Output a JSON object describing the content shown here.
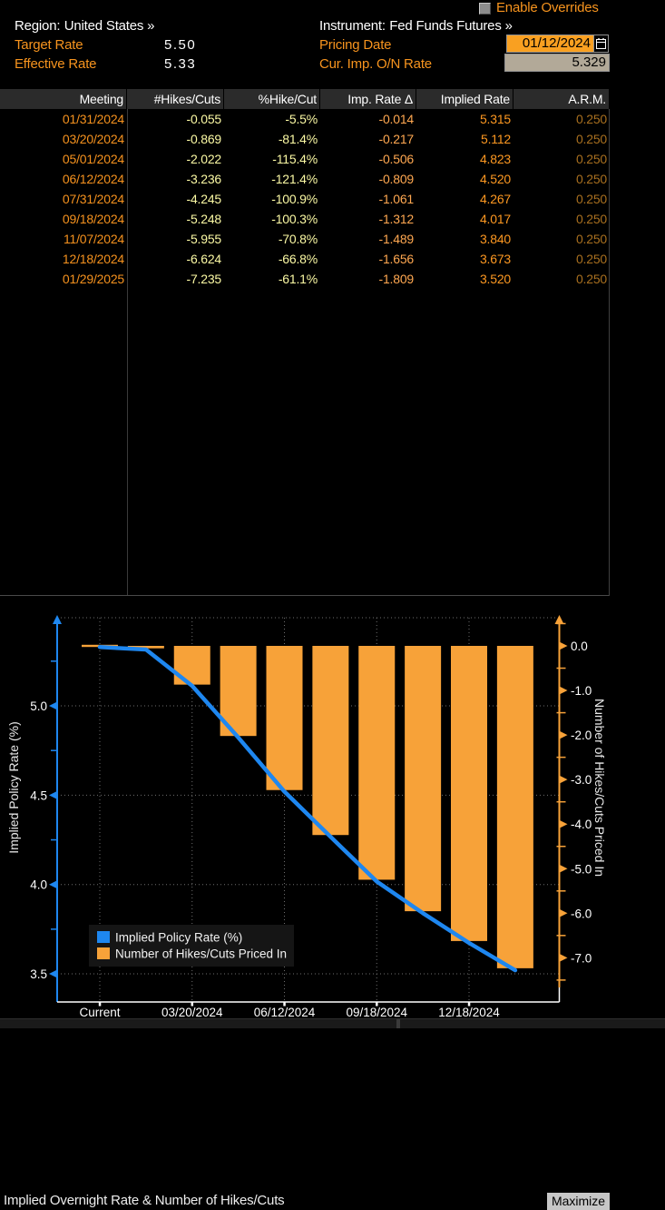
{
  "header": {
    "enable_overrides_label": "Enable Overrides",
    "region_label": "Region:",
    "region_value": "United States »",
    "instrument_label": "Instrument:",
    "instrument_value": "Fed Funds Futures »",
    "target_rate_label": "Target Rate",
    "target_rate_value": "5.50",
    "effective_rate_label": "Effective Rate",
    "effective_rate_value": "5.33",
    "pricing_date_label": "Pricing Date",
    "pricing_date_value": "01/12/2024",
    "cur_imp_on_rate_label": "Cur. Imp. O/N Rate",
    "cur_imp_on_rate_value": "5.329",
    "calendar_icon": "calendar-icon"
  },
  "table": {
    "columns": [
      "Meeting",
      "#Hikes/Cuts",
      "%Hike/Cut",
      "Imp. Rate Δ",
      "Implied Rate",
      "A.R.M."
    ],
    "rows": [
      [
        "01/31/2024",
        "-0.055",
        "-5.5%",
        "-0.014",
        "5.315",
        "0.250"
      ],
      [
        "03/20/2024",
        "-0.869",
        "-81.4%",
        "-0.217",
        "5.112",
        "0.250"
      ],
      [
        "05/01/2024",
        "-2.022",
        "-115.4%",
        "-0.506",
        "4.823",
        "0.250"
      ],
      [
        "06/12/2024",
        "-3.236",
        "-121.4%",
        "-0.809",
        "4.520",
        "0.250"
      ],
      [
        "07/31/2024",
        "-4.245",
        "-100.9%",
        "-1.061",
        "4.267",
        "0.250"
      ],
      [
        "09/18/2024",
        "-5.248",
        "-100.3%",
        "-1.312",
        "4.017",
        "0.250"
      ],
      [
        "11/07/2024",
        "-5.955",
        "-70.8%",
        "-1.489",
        "3.840",
        "0.250"
      ],
      [
        "12/18/2024",
        "-6.624",
        "-66.8%",
        "-1.656",
        "3.673",
        "0.250"
      ],
      [
        "01/29/2025",
        "-7.235",
        "-61.1%",
        "-1.809",
        "3.520",
        "0.250"
      ]
    ]
  },
  "chart": {
    "title": "Implied Overnight Rate & Number of Hikes/Cuts",
    "maximize_label": "Maximize"
  },
  "chart_data": {
    "type": "line+bar",
    "title": "Implied Overnight Rate & Number of Hikes/Cuts",
    "x_categories": [
      "Current",
      "01/31/2024",
      "03/20/2024",
      "05/01/2024",
      "06/12/2024",
      "07/31/2024",
      "09/18/2024",
      "11/07/2024",
      "12/18/2024",
      "01/29/2025"
    ],
    "x_tick_indices": [
      0,
      2,
      4,
      6,
      8
    ],
    "x_tick_labels": [
      "Current",
      "03/20/2024",
      "06/12/2024",
      "09/18/2024",
      "12/18/2024"
    ],
    "series": [
      {
        "name": "Implied Policy Rate (%)",
        "type": "line",
        "axis": "left",
        "color": "#1e87f0",
        "values": [
          5.329,
          5.315,
          5.112,
          4.823,
          4.52,
          4.267,
          4.017,
          3.84,
          3.673,
          3.52
        ]
      },
      {
        "name": "Number of Hikes/Cuts Priced In",
        "type": "bar",
        "axis": "right",
        "color": "#f7a239",
        "values": [
          0.0,
          -0.055,
          -0.869,
          -2.022,
          -3.236,
          -4.245,
          -5.248,
          -5.955,
          -6.624,
          -7.235
        ]
      }
    ],
    "left_axis": {
      "label": "Implied Policy Rate (%)",
      "ticks": [
        5.0,
        4.5,
        4.0,
        3.5
      ],
      "range": [
        3.34,
        5.5
      ]
    },
    "right_axis": {
      "label": "Number of Hikes/Cuts Priced In",
      "ticks": [
        0.0,
        -1.0,
        -2.0,
        -3.0,
        -4.0,
        -5.0,
        -6.0,
        -7.0
      ],
      "range": [
        -8.0,
        0.7
      ]
    },
    "grid": true,
    "legend_position": "bottom-left",
    "colors": {
      "line_blue": "#1e87f0",
      "bar_orange": "#f7a239",
      "grid_gray": "#6e6e6e"
    }
  }
}
